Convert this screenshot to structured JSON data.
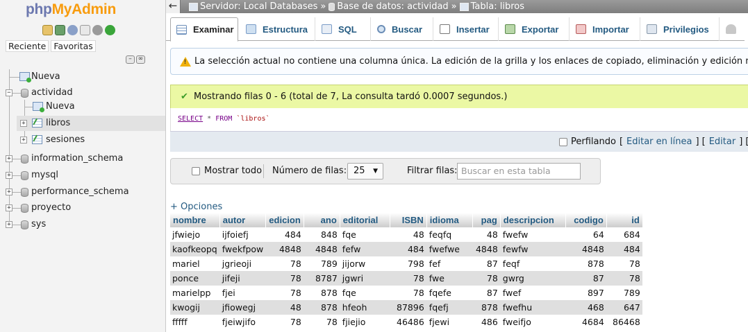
{
  "nav": {
    "logo_php": "php",
    "logo_myadmin": "MyAdmin",
    "icons": [
      "home-icon",
      "sql-query-icon",
      "docs-icon",
      "doc-page-icon",
      "gear-icon",
      "reload-icon"
    ],
    "tab_recent": "Reciente",
    "tab_favorites": "Favoritas",
    "tree": {
      "new": "Nueva",
      "db_actividad": "actividad",
      "actividad_new": "Nueva",
      "table_libros": "libros",
      "table_sesiones": "sesiones",
      "db_information_schema": "information_schema",
      "db_mysql": "mysql",
      "db_performance_schema": "performance_schema",
      "db_proyecto": "proyecto",
      "db_sys": "sys"
    }
  },
  "breadcrumb": {
    "back": "←",
    "server": "Servidor: Local Databases",
    "sep1": "»",
    "database": "Base de datos: actividad",
    "sep2": "»",
    "table": "Tabla: libros"
  },
  "tabs": [
    {
      "label": "Examinar",
      "icon": "browse-icon",
      "active": true
    },
    {
      "label": "Estructura",
      "icon": "structure-icon"
    },
    {
      "label": "SQL",
      "icon": "sql-icon"
    },
    {
      "label": "Buscar",
      "icon": "search-icon"
    },
    {
      "label": "Insertar",
      "icon": "insert-icon"
    },
    {
      "label": "Exportar",
      "icon": "export-icon"
    },
    {
      "label": "Importar",
      "icon": "import-icon"
    },
    {
      "label": "Privilegios",
      "icon": "privileges-icon"
    }
  ],
  "warning": "La selección actual no contiene una columna única. La edición de la grilla y los enlaces de copiado, eliminación y edición no están dispon",
  "success": "Mostrando filas 0 - 6 (total de 7, La consulta tardó 0.0007 segundos.)",
  "sql": {
    "select": "SELECT",
    "star": "*",
    "from": "FROM",
    "table": "`libros`"
  },
  "profiling": {
    "label": "Perfilando",
    "bracket_open": "[",
    "edit_inline": "Editar en línea",
    "sep": "] [",
    "edit": "Editar",
    "explain": "] [ Expl"
  },
  "navbar": {
    "show_all": "Mostrar todo",
    "rows_label": "Número de filas:",
    "rows_value": "25",
    "filter_label": "Filtrar filas:",
    "filter_placeholder": "Buscar en esta tabla"
  },
  "options_link": "+ Opciones",
  "table": {
    "columns": [
      "nombre",
      "autor",
      "edicion",
      "ano",
      "editorial",
      "ISBN",
      "idioma",
      "pag",
      "descripcion",
      "codigo",
      "id"
    ],
    "numeric": [
      false,
      false,
      true,
      true,
      false,
      true,
      false,
      true,
      false,
      true,
      true
    ],
    "rows": [
      [
        "jfwiejo",
        "ijfoiefj",
        "484",
        "848",
        "fqe",
        "48",
        "feqfq",
        "48",
        "fwefw",
        "64",
        "684"
      ],
      [
        "kaofkeopq",
        "fwekfpow",
        "4848",
        "4848",
        "fefw",
        "484",
        "fwefwe",
        "4848",
        "fewfw",
        "4848",
        "484"
      ],
      [
        "mariel",
        "jgrieoji",
        "78",
        "789",
        "jijorw",
        "798",
        "fef",
        "87",
        "feqf",
        "878",
        "78"
      ],
      [
        "ponce",
        "jifeji",
        "78",
        "8787",
        "jgwri",
        "78",
        "fwe",
        "78",
        "gwrg",
        "87",
        "78"
      ],
      [
        "marielpp",
        "fjei",
        "78",
        "878",
        "fqe",
        "78",
        "fqefe",
        "87",
        "fwef",
        "897",
        "789"
      ],
      [
        "kwogij",
        "jfiowegj",
        "48",
        "878",
        "hfeoh",
        "87896",
        "fqefj",
        "878",
        "fwefhu",
        "468",
        "647"
      ],
      [
        "fffff",
        "fjeiwjifo",
        "78",
        "78",
        "fjiejio",
        "46486",
        "fjewi",
        "486",
        "fweifjo",
        "4684",
        "86468"
      ]
    ]
  }
}
